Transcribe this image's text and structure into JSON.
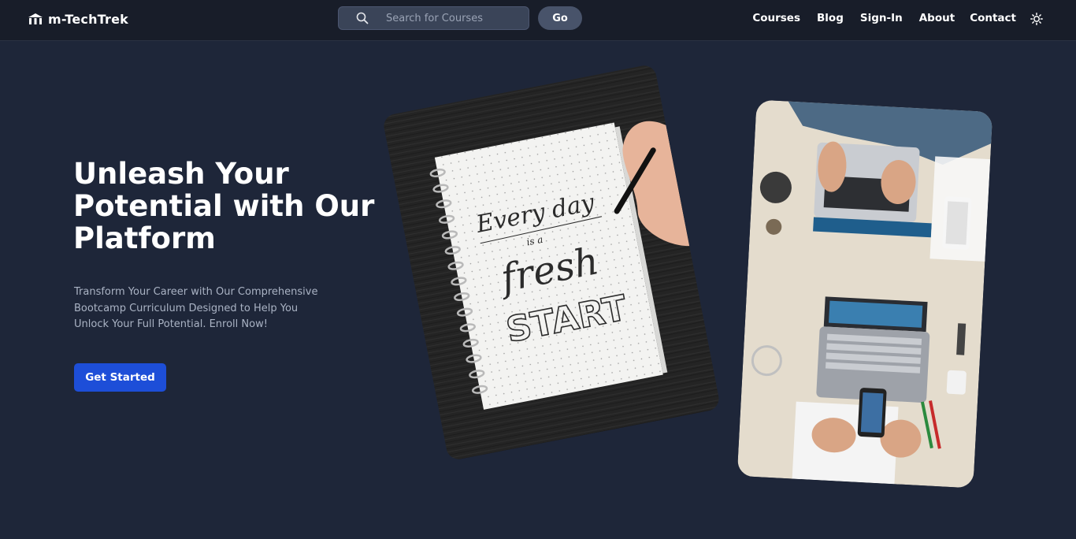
{
  "brand": {
    "name": "m-TechTrek",
    "logo_icon": "building-columns-icon"
  },
  "search": {
    "placeholder": "Search for Courses",
    "value": "",
    "icon": "search-icon"
  },
  "go_label": "Go",
  "nav": {
    "items": [
      {
        "label": "Courses"
      },
      {
        "label": "Blog"
      },
      {
        "label": "Sign-In"
      },
      {
        "label": "About"
      },
      {
        "label": "Contact"
      }
    ],
    "theme_toggle_icon": "sun-icon"
  },
  "hero": {
    "title": "Unleash Your Potential with Our Platform",
    "subtitle": "Transform Your Career with Our Comprehensive Bootcamp Curriculum Designed to Help You Unlock Your Full Potential. Enroll Now!",
    "cta_label": "Get Started"
  },
  "images": {
    "notebook": {
      "lettering": {
        "line1": "Every day",
        "line2": "is a",
        "line3": "fresh",
        "line4": "START"
      }
    },
    "desk": {}
  },
  "colors": {
    "background": "#1e2639",
    "navbar": "#181d29",
    "accent": "#1d4ed8",
    "muted_text": "#aab3c4"
  }
}
